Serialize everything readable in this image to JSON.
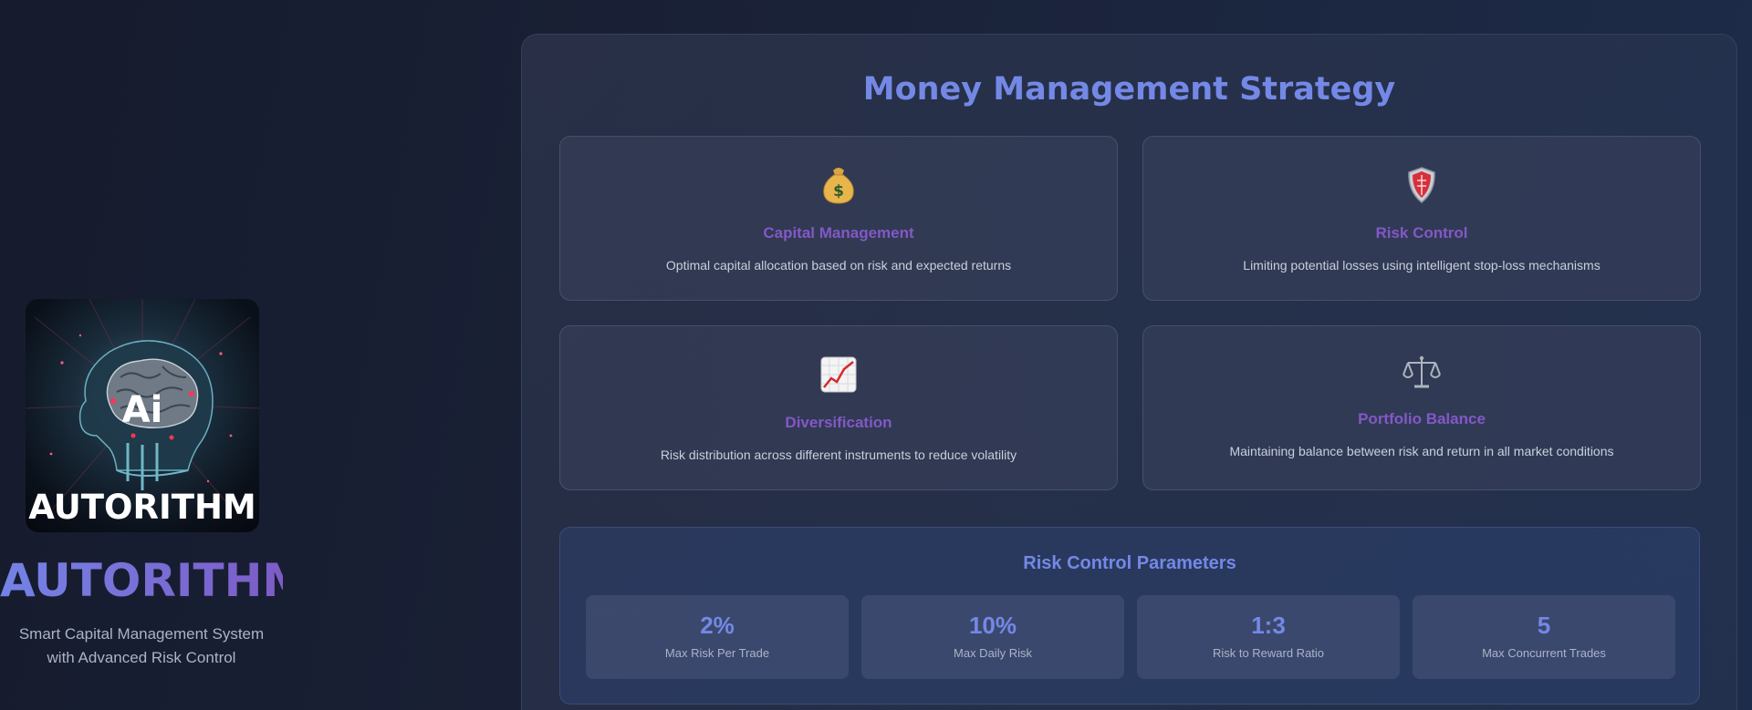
{
  "brand": {
    "logo_badge": "Ai",
    "logo_wordmark": "AUTORITHM",
    "title": "AUTORITHM",
    "tagline_line1": "Smart Capital Management System",
    "tagline_line2": "with Advanced Risk Control"
  },
  "panel": {
    "title": "Money Management Strategy",
    "cards": [
      {
        "icon": "money-bag-icon",
        "emoji": "💰",
        "title": "Capital Management",
        "desc": "Optimal capital allocation based on risk and expected returns"
      },
      {
        "icon": "shield-icon",
        "emoji": "🛡",
        "title": "Risk Control",
        "desc": "Limiting potential losses using intelligent stop-loss mechanisms"
      },
      {
        "icon": "chart-increasing-icon",
        "emoji": "📈",
        "title": "Diversification",
        "desc": "Risk distribution across different instruments to reduce volatility"
      },
      {
        "icon": "balance-scale-icon",
        "emoji": "⚖",
        "title": "Portfolio Balance",
        "desc": "Maintaining balance between risk and return in all market conditions"
      }
    ],
    "params": {
      "title": "Risk Control Parameters",
      "items": [
        {
          "value": "2%",
          "label": "Max Risk Per Trade"
        },
        {
          "value": "10%",
          "label": "Max Daily Risk"
        },
        {
          "value": "1:3",
          "label": "Risk to Reward Ratio"
        },
        {
          "value": "5",
          "label": "Max Concurrent Trades"
        }
      ]
    }
  },
  "colors": {
    "accent": "#7488e6",
    "card_title": "#8358c6",
    "background": "#1a2238"
  }
}
